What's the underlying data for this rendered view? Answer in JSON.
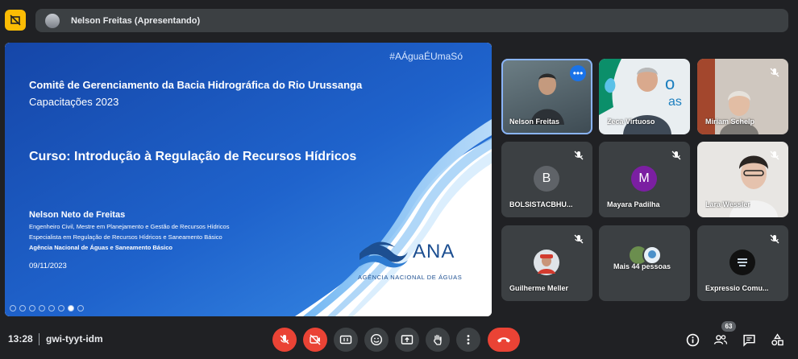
{
  "presenter_bar": {
    "text": "Nelson Freitas (Apresentando)"
  },
  "slide": {
    "hashtag": "#AÁguaÉUmaSó",
    "committee": "Comitê de Gerenciamento da Bacia Hidrográfica do Rio Urussanga",
    "subtitle": "Capacitações 2023",
    "course": "Curso: Introdução à Regulação de Recursos Hídricos",
    "presenter_name": "Nelson Neto de Freitas",
    "presenter_line1": "Engenheiro Civil, Mestre em Planejamento e Gestão de Recursos Hídricos",
    "presenter_line2": "Especialista em Regulação de Recursos Hídricos e Saneamento Básico",
    "presenter_line3": "Agência Nacional de Águas e Saneamento Básico",
    "date": "09/11/2023",
    "logo_name": "ANA",
    "logo_subtitle": "AGÊNCIA NACIONAL DE ÁGUAS"
  },
  "participants": [
    {
      "name": "Nelson Freitas"
    },
    {
      "name": "Zeca Virtuoso"
    },
    {
      "name": "Miriam Schelp"
    },
    {
      "name": "BOLSISTACBHU...",
      "initial": "B",
      "color": "#5f6368"
    },
    {
      "name": "Mayara Padilha",
      "initial": "M",
      "color": "#7b1fa2"
    },
    {
      "name": "Lara Wessler"
    },
    {
      "name": "Guilherme Meller"
    },
    {
      "name": "Mais 44 pessoas"
    },
    {
      "name": "Expressio Comu..."
    }
  ],
  "bottom": {
    "time": "13:28",
    "meeting_code": "gwi-tyyt-idm",
    "participant_count": "63"
  },
  "colors": {
    "background": "#202124",
    "tile": "#3c4043",
    "danger": "#ea4335",
    "accent": "#8ab4f8",
    "shield": "#fbbc04"
  }
}
